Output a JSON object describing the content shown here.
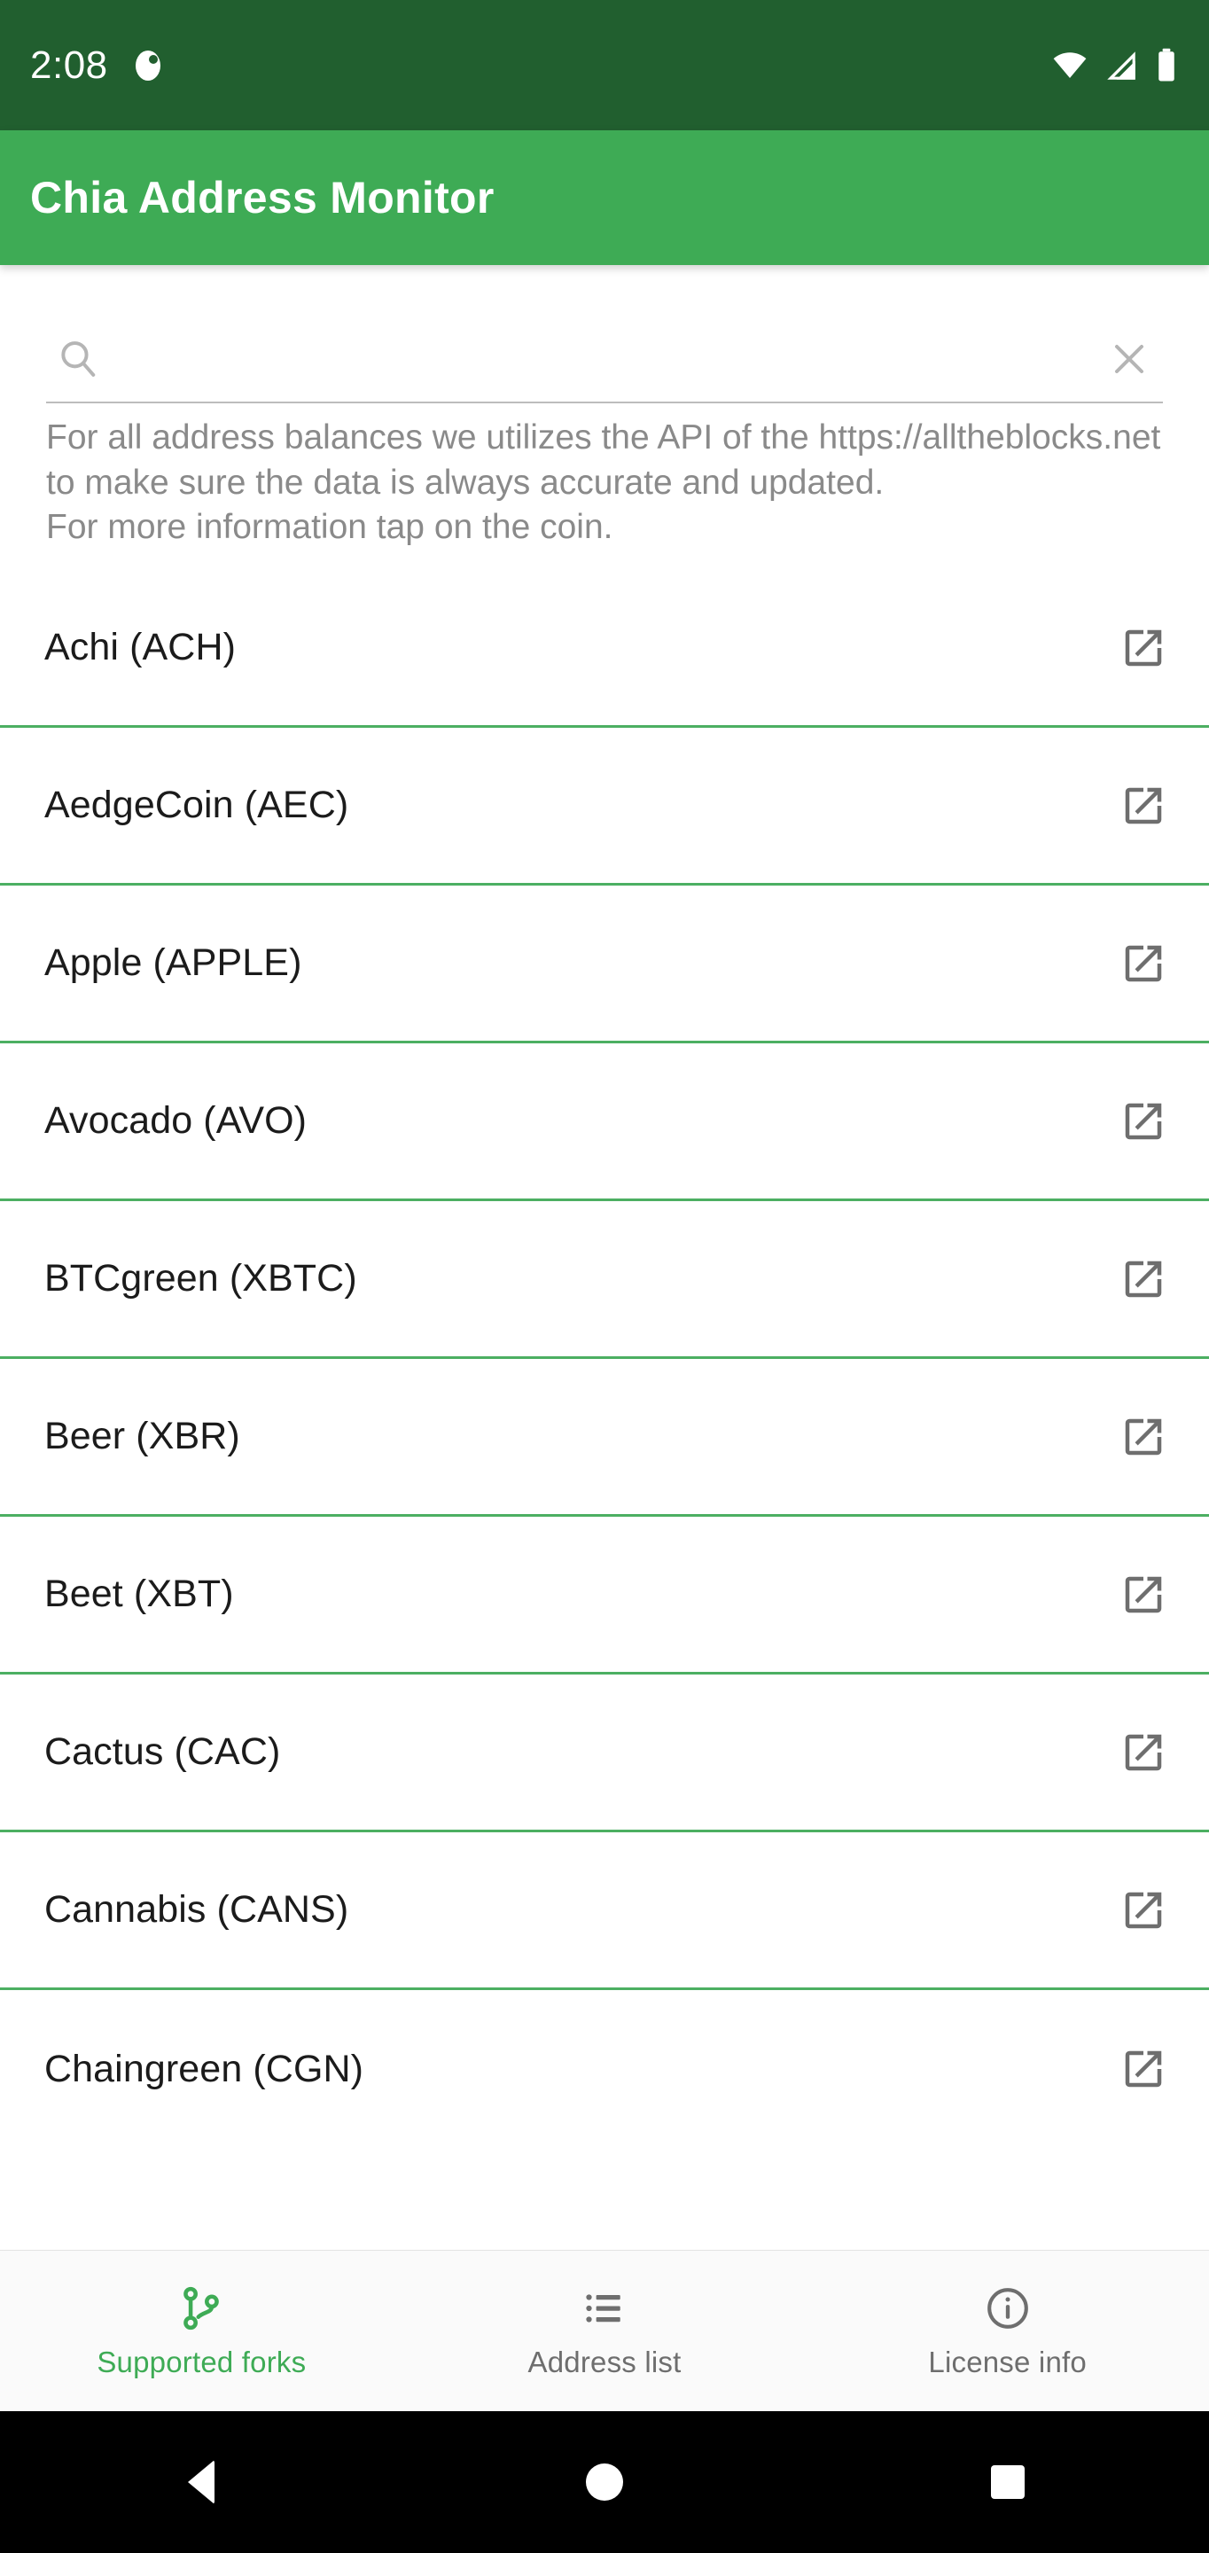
{
  "status_bar": {
    "time": "2:08",
    "icons": [
      "notification-dot-icon",
      "wifi-icon",
      "cell-signal-icon",
      "battery-icon"
    ],
    "background_color": "#215F2F"
  },
  "app_bar": {
    "title": "Chia Address Monitor",
    "background_color": "#3EAB55"
  },
  "search": {
    "value": "",
    "placeholder": "",
    "search_icon": "search-icon",
    "clear_icon": "close-icon"
  },
  "info": {
    "text": "For all address balances we utilizes the API of the https://alltheblocks.net to make sure the data is always accurate and updated.\nFor more information tap on the coin."
  },
  "list": {
    "divider_color": "#4CAF62",
    "row_icon": "open-in-new-icon",
    "items": [
      {
        "label": "Achi (ACH)"
      },
      {
        "label": "AedgeCoin (AEC)"
      },
      {
        "label": "Apple (APPLE)"
      },
      {
        "label": "Avocado (AVO)"
      },
      {
        "label": "BTCgreen (XBTC)"
      },
      {
        "label": "Beer (XBR)"
      },
      {
        "label": "Beet (XBT)"
      },
      {
        "label": "Cactus (CAC)"
      },
      {
        "label": "Cannabis (CANS)"
      },
      {
        "label": "Chaingreen (CGN)"
      }
    ]
  },
  "bottom_nav": {
    "active_color": "#3EAB55",
    "inactive_color": "#6E6E6E",
    "items": [
      {
        "label": "Supported forks",
        "icon": "fork-icon",
        "active": true
      },
      {
        "label": "Address list",
        "icon": "list-icon",
        "active": false
      },
      {
        "label": "License info",
        "icon": "info-circle-icon",
        "active": false
      }
    ]
  },
  "android_nav": {
    "back": "back-triangle-icon",
    "home": "home-circle-icon",
    "recents": "recents-square-icon"
  }
}
